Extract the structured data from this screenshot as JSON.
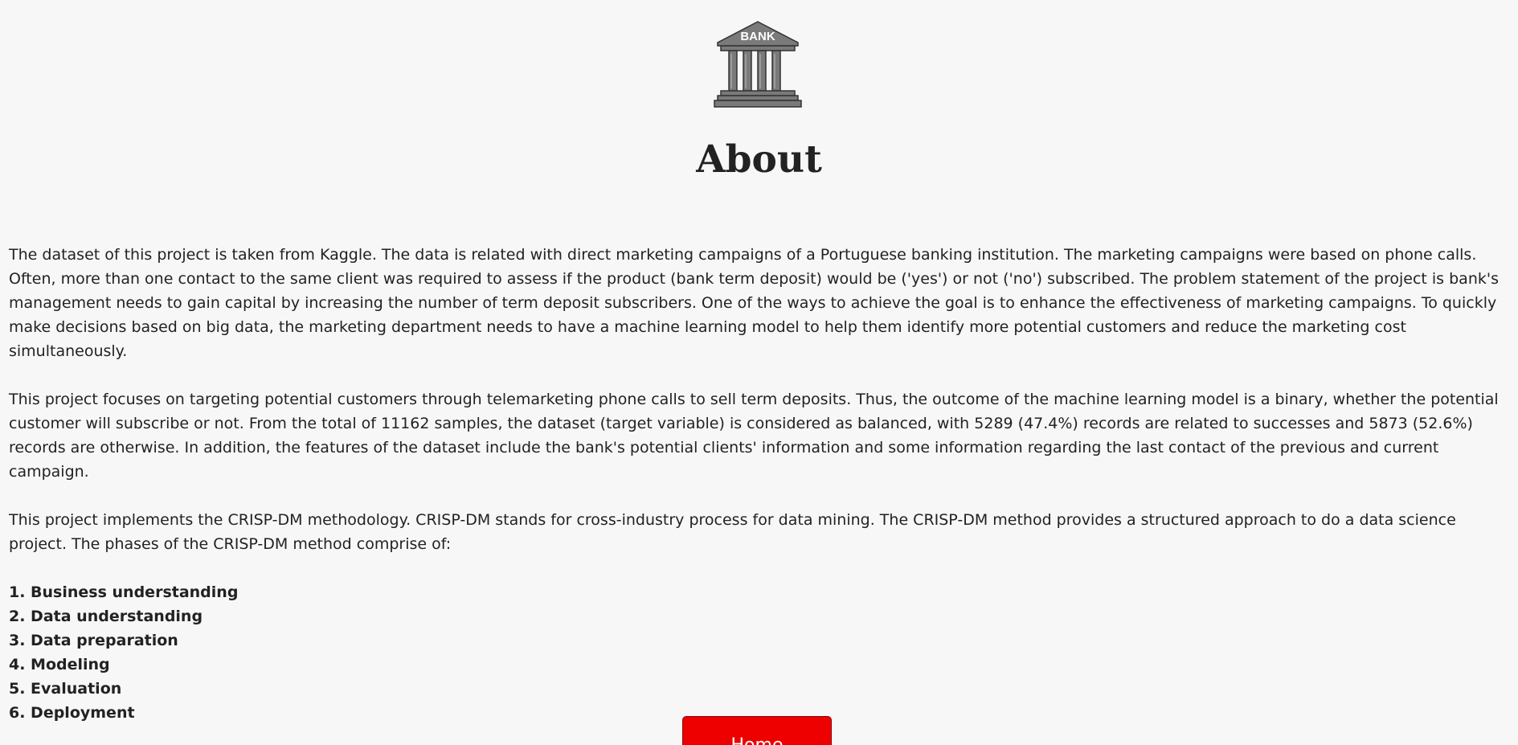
{
  "logo": {
    "text": "BANK",
    "icon": "bank-building-icon"
  },
  "page_title": "About",
  "paragraphs": [
    "The dataset of this project is taken from Kaggle. The data is related with direct marketing campaigns of a Portuguese banking institution. The marketing campaigns were based on phone calls. Often, more than one contact to the same client was required to assess if the product (bank term deposit) would be ('yes') or not ('no') subscribed. The problem statement of the project is bank's management needs to gain capital by increasing the number of term deposit subscribers. One of the ways to achieve the goal is to enhance the effectiveness of marketing campaigns. To quickly make decisions based on big data, the marketing department needs to have a machine learning model to help them identify more potential customers and reduce the marketing cost simultaneously.",
    "This project focuses on targeting potential customers through telemarketing phone calls to sell term deposits. Thus, the outcome of the machine learning model is a binary, whether the potential customer will subscribe or not. From the total of 11162 samples, the dataset (target variable) is considered as balanced, with 5289 (47.4%) records are related to successes and 5873 (52.6%) records are otherwise. In addition, the features of the dataset include the bank's potential clients' information and some information regarding the last contact of the previous and current campaign.",
    "This project implements the CRISP-DM methodology. CRISP-DM stands for cross-industry process for data mining. The CRISP-DM method provides a structured approach to do a data science project. The phases of the CRISP-DM method comprise of:"
  ],
  "phases": [
    "1. Business understanding",
    "2. Data understanding",
    "3. Data preparation",
    "4. Modeling",
    "5. Evaluation",
    "6. Deployment"
  ],
  "home_button_label": "Home",
  "colors": {
    "button": "#ee0000",
    "logo_gray": "#7a7a7a",
    "text": "#222222"
  }
}
